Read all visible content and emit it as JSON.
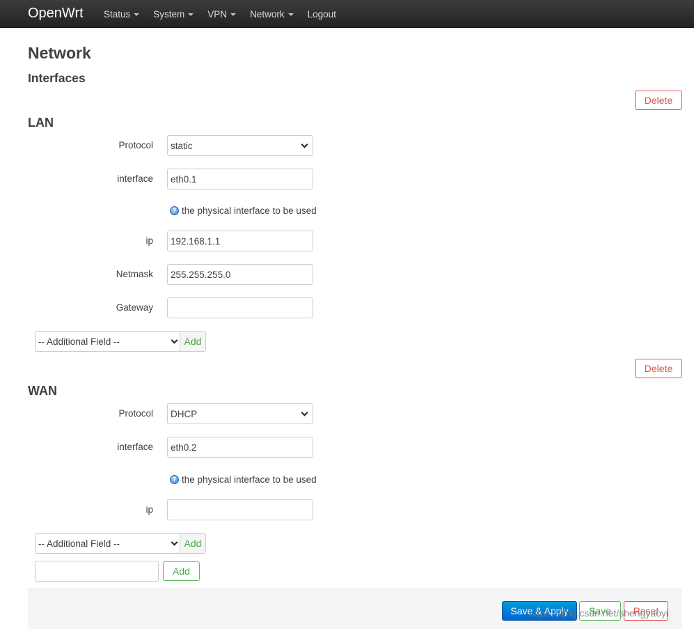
{
  "brand": "OpenWrt",
  "menu": [
    "Status",
    "System",
    "VPN",
    "Network",
    "Logout"
  ],
  "page_title": "Network",
  "subtitle": "Interfaces",
  "delete_label": "Delete",
  "lan": {
    "title": "LAN",
    "protocol_label": "Protocol",
    "protocol_value": "static",
    "interface_label": "interface",
    "interface_value": "eth0.1",
    "interface_help": "the physical interface to be used",
    "ip_label": "ip",
    "ip_value": "192.168.1.1",
    "netmask_label": "Netmask",
    "netmask_value": "255.255.255.0",
    "gateway_label": "Gateway",
    "gateway_value": "",
    "additional_field": "-- Additional Field --",
    "add_label": "Add"
  },
  "wan": {
    "title": "WAN",
    "protocol_label": "Protocol",
    "protocol_value": "DHCP",
    "interface_label": "interface",
    "interface_value": "eth0.2",
    "interface_help": "the physical interface to be used",
    "ip_label": "ip",
    "ip_value": "",
    "additional_field": "-- Additional Field --",
    "add_label": "Add"
  },
  "new_section": {
    "name_value": "",
    "add_label": "Add"
  },
  "footer": {
    "save_apply": "Save & Apply",
    "save": "Save",
    "reset": "Reset"
  },
  "watermark": "https://blog.csdn.net/shengyaoyi",
  "colors": {
    "danger": "#d9534f",
    "success": "#5cb85c",
    "primary": "#0069d6",
    "navbar": "#2b2b2b"
  }
}
